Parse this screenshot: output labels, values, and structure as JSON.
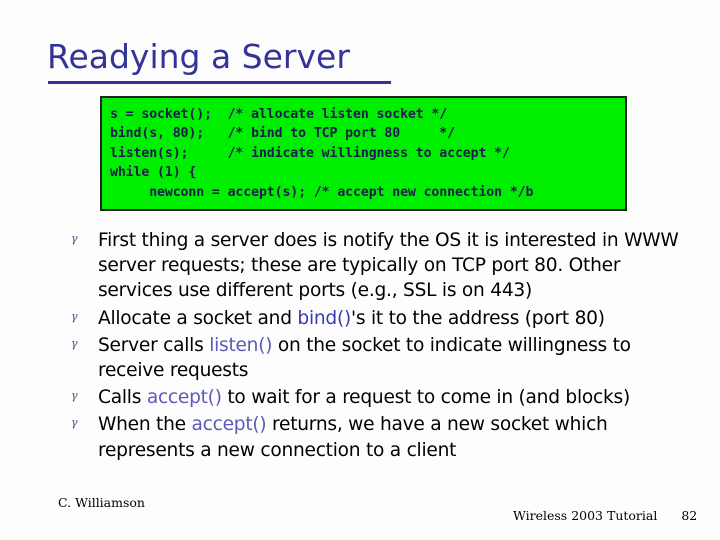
{
  "slide": {
    "title": "Readying a Server",
    "title_color": "#333399",
    "background_color": "#fdfdfd"
  },
  "code_block": {
    "background_color": "#00ee00",
    "border_color": "#232323",
    "text_color": "#1b1b4d",
    "text": "s = socket();  /* allocate listen socket */\nbind(s, 80);   /* bind to TCP port 80     */\nlisten(s);     /* indicate willingness to accept */\nwhile (1) {\n     newconn = accept(s); /* accept new connection */b",
    "lines": [
      "s = socket();  /* allocate listen socket */",
      "bind(s, 80);   /* bind to TCP port 80     */",
      "listen(s);     /* indicate willingness to accept */",
      "while (1) {",
      "     newconn = accept(s); /* accept new connection */b"
    ]
  },
  "bullets": {
    "marker_glyph": "γ",
    "marker_color": "#4b4b82",
    "code_color": "#3b3bb0",
    "items": [
      {
        "parts": [
          {
            "text": "First thing a server does is notify the OS it is interested in WWW server requests; these are typically on TCP port 80. Other services use different ports (e.g., SSL is on 443)",
            "style": "plain"
          }
        ],
        "plain_text": "First thing a server does is notify the OS it is interested in WWW server requests; these are typically on TCP port 80. Other services use different ports (e.g., SSL is on 443)"
      },
      {
        "parts": [
          {
            "text": "Allocate a socket and ",
            "style": "plain"
          },
          {
            "text": "bind()",
            "style": "code"
          },
          {
            "text": "'s it to the address (port 80)",
            "style": "plain"
          }
        ],
        "plain_text": "Allocate a socket and bind()'s it to the address (port 80)"
      },
      {
        "parts": [
          {
            "text": "Server calls ",
            "style": "plain"
          },
          {
            "text": "listen()",
            "style": "code"
          },
          {
            "text": " on the socket to indicate willingness to receive requests",
            "style": "plain"
          }
        ],
        "plain_text": "Server calls listen() on the socket to indicate willingness to receive requests"
      },
      {
        "parts": [
          {
            "text": "Calls ",
            "style": "plain"
          },
          {
            "text": "accept()",
            "style": "code"
          },
          {
            "text": " to wait for a request to come in (and blocks)",
            "style": "plain"
          }
        ],
        "plain_text": "Calls accept() to wait for a request to come in (and blocks)"
      },
      {
        "parts": [
          {
            "text": "When the ",
            "style": "plain"
          },
          {
            "text": "accept()",
            "style": "code"
          },
          {
            "text": " returns, we have a new socket which represents a new connection to a client",
            "style": "plain"
          }
        ],
        "plain_text": "When the accept() returns, we have a new socket which represents a new connection to a client"
      }
    ]
  },
  "footer": {
    "author": "C. Williamson",
    "tutorial": "Wireless 2003 Tutorial",
    "page_number": "82"
  }
}
